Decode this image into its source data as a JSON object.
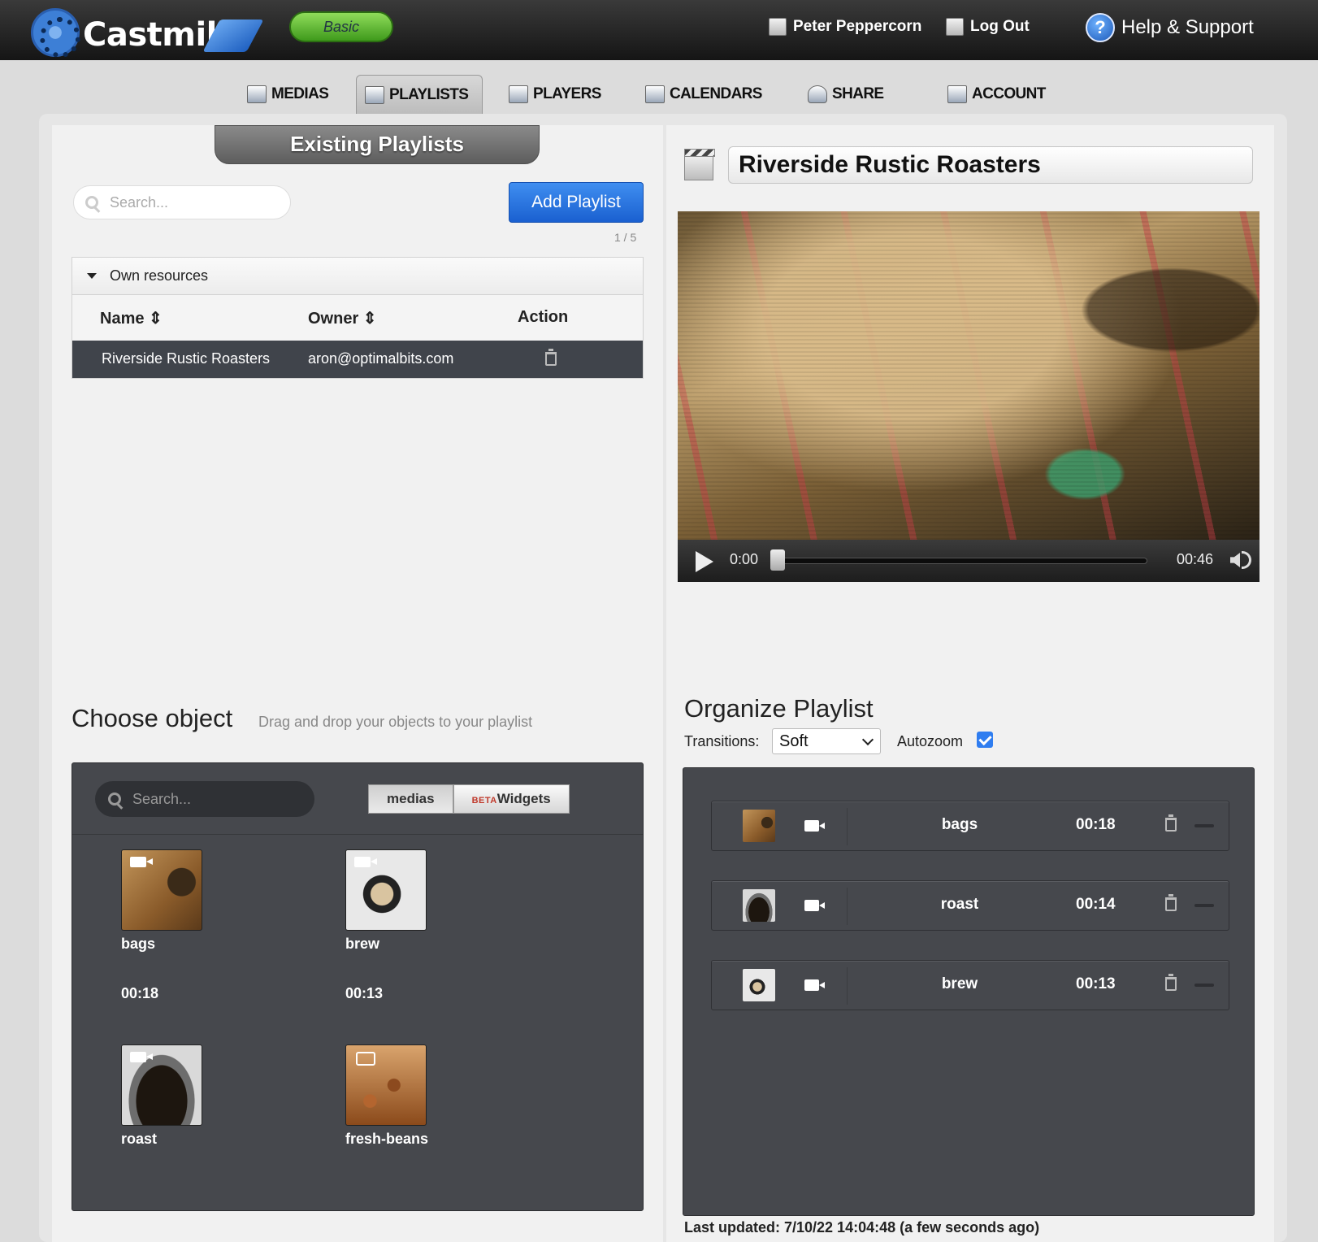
{
  "header": {
    "logo_text": "Castmill",
    "plan_badge": "Basic",
    "user_name": "Peter Peppercorn",
    "logout_label": "Log Out",
    "help_label": "Help & Support"
  },
  "nav": [
    {
      "label": "MEDIAS",
      "icon": "image-icon"
    },
    {
      "label": "PLAYLISTS",
      "icon": "playlist-icon",
      "active": true
    },
    {
      "label": "PLAYERS",
      "icon": "monitor-icon"
    },
    {
      "label": "CALENDARS",
      "icon": "calendar-icon"
    },
    {
      "label": "SHARE",
      "icon": "person-icon"
    },
    {
      "label": "ACCOUNT",
      "icon": "account-icon"
    }
  ],
  "existing": {
    "tab_title": "Existing Playlists",
    "search_placeholder": "Search...",
    "add_button": "Add Playlist",
    "pager": "1 / 5",
    "group_label": "Own resources",
    "columns": [
      "Name ⇕",
      "Owner ⇕",
      "Action"
    ],
    "rows": [
      {
        "name": "Riverside Rustic Roasters",
        "owner": "aron@optimalbits.com"
      }
    ]
  },
  "choose": {
    "title": "Choose object",
    "hint": "Drag and drop your objects to your playlist",
    "search_placeholder": "Search...",
    "tabs": {
      "medias": "medias",
      "beta": "BETA",
      "widgets": "Widgets"
    },
    "items": [
      {
        "name": "bags",
        "duration": "00:18",
        "type": "video"
      },
      {
        "name": "brew",
        "duration": "00:13",
        "type": "video"
      },
      {
        "name": "roast",
        "duration": "",
        "type": "video"
      },
      {
        "name": "fresh-beans",
        "duration": "",
        "type": "image"
      }
    ]
  },
  "playlist": {
    "title": "Riverside Rustic Roasters",
    "player": {
      "current_time": "0:00",
      "total_time": "00:46",
      "progress": 0
    }
  },
  "organize": {
    "title": "Organize Playlist",
    "transitions_label": "Transitions:",
    "transition_value": "Soft",
    "autozoom_label": "Autozoom",
    "autozoom_checked": true,
    "items": [
      {
        "name": "bags",
        "duration": "00:18"
      },
      {
        "name": "roast",
        "duration": "00:14"
      },
      {
        "name": "brew",
        "duration": "00:13"
      }
    ],
    "last_updated": "Last updated: 7/10/22 14:04:48 (a few seconds ago)"
  },
  "colors": {
    "accent_blue": "#1a60d0",
    "badge_green": "#3f9a1c",
    "dark_panel": "#46484d",
    "header_dark": "#151515"
  }
}
